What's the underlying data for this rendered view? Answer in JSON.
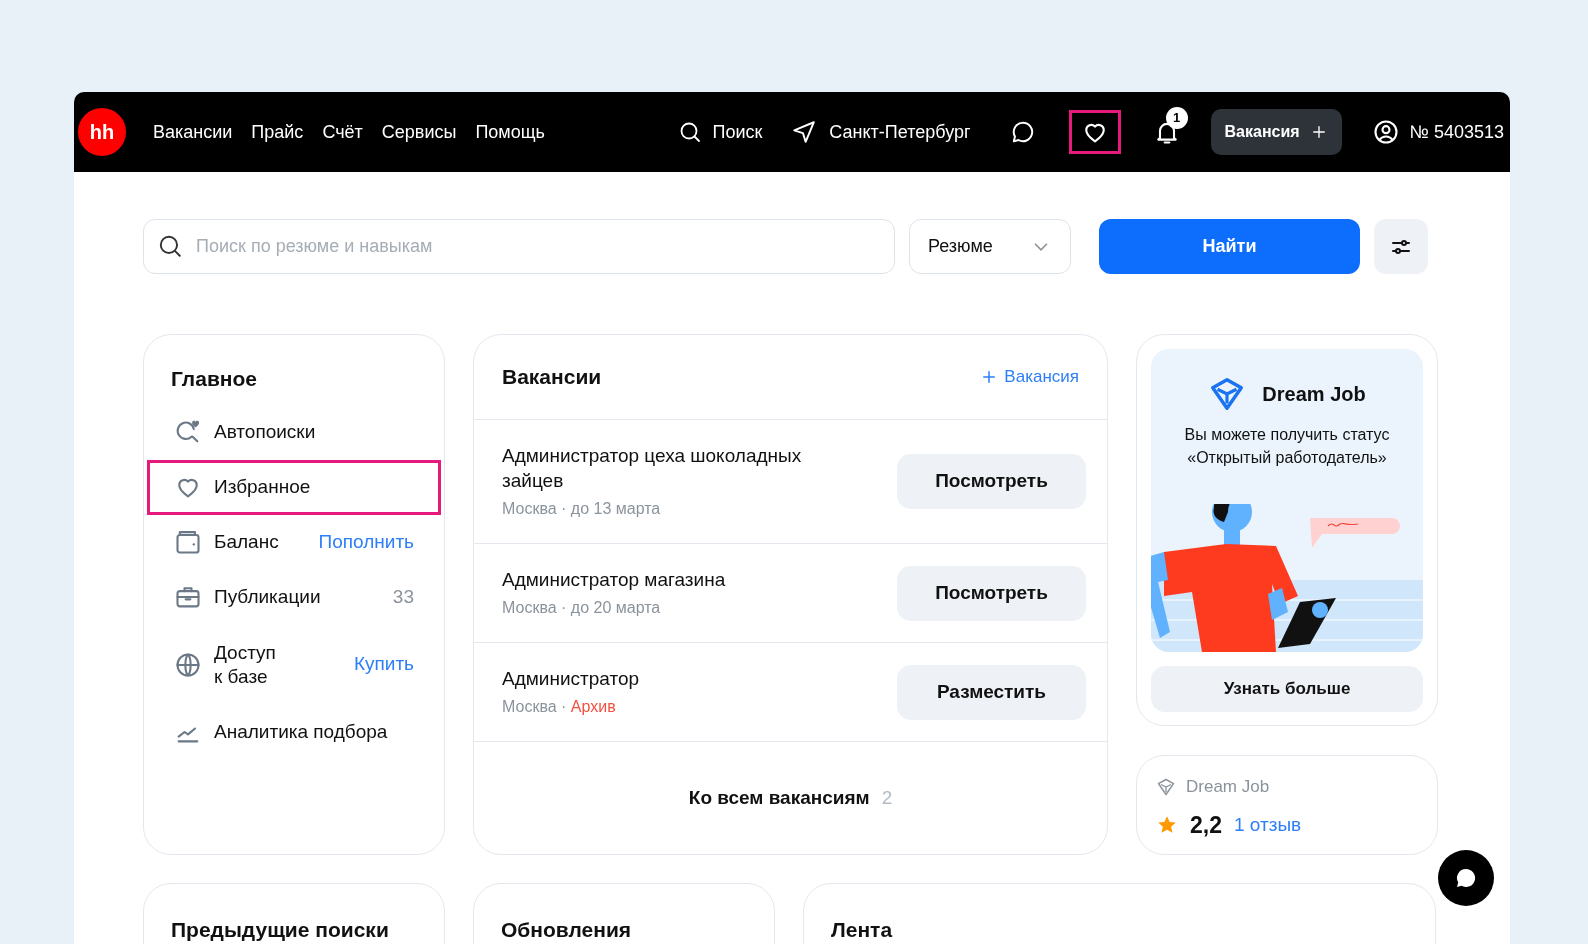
{
  "header": {
    "logo": "hh",
    "nav": [
      "Вакансии",
      "Прайс",
      "Счёт",
      "Сервисы",
      "Помощь"
    ],
    "search": "Поиск",
    "city": "Санкт-Петербург",
    "icons": [
      {
        "kind": "chat",
        "highlighted": false
      },
      {
        "kind": "favorites",
        "highlighted": true
      },
      {
        "kind": "notifications",
        "highlighted": false,
        "badge": "1"
      }
    ],
    "create_button": "Вакансия",
    "account": "№ 5403513"
  },
  "search_bar": {
    "placeholder": "Поиск по резюме и навыкам",
    "select": "Резюме",
    "button": "Найти"
  },
  "main_menu": {
    "title": "Главное",
    "items": [
      {
        "label": "Автопоиски",
        "kind": "plain",
        "highlighted": false
      },
      {
        "label": "Избранное",
        "kind": "plain",
        "highlighted": true
      },
      {
        "label": "Баланс",
        "kind": "link",
        "extra": "Пополнить",
        "highlighted": false
      },
      {
        "label": "Публикации",
        "kind": "count",
        "extra": "33",
        "highlighted": false
      },
      {
        "label": "Доступ к базе",
        "kind": "link",
        "extra": "Купить",
        "highlighted": false
      },
      {
        "label": "Аналитика подбора",
        "kind": "plain",
        "highlighted": false
      }
    ]
  },
  "vacancies": {
    "title": "Вакансии",
    "add_link": "Вакансия",
    "rows": [
      {
        "title": "Администратор цеха шоколадных зайцев",
        "city": "Москва ·",
        "note": "до 13 марта",
        "archived": false,
        "button": "Посмотреть"
      },
      {
        "title": "Администратор магазина",
        "city": "Москва ·",
        "note": "до 20 марта",
        "archived": false,
        "button": "Посмотреть"
      },
      {
        "title": "Администратор",
        "city": "Москва ·",
        "note": "Архив",
        "archived": true,
        "button": "Разместить"
      }
    ],
    "footer": {
      "label": "Ко всем вакансиям",
      "count": "2"
    }
  },
  "promo": {
    "title": "Dream Job",
    "text": "Вы можете получить статус «Открытый работодатель»",
    "button": "Узнать больше"
  },
  "rating": {
    "title": "Dream Job",
    "score": "2,2",
    "reviews": "1 отзыв"
  },
  "bottom_cards": [
    "Предыдущие поиски",
    "Обновления",
    "Лента"
  ]
}
